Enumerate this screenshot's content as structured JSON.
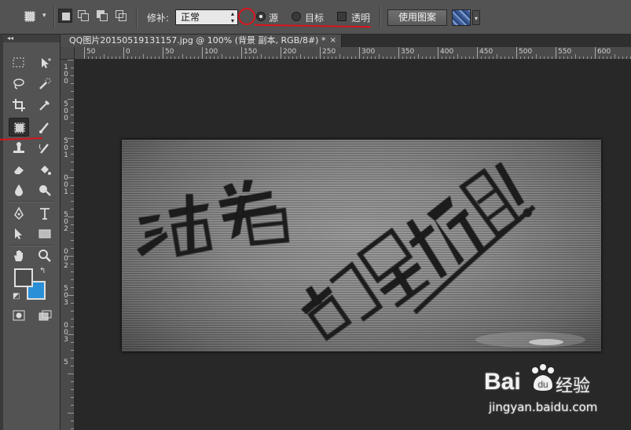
{
  "options_bar": {
    "tool_preset_icon": "patch-tool-icon",
    "patch_label": "修补:",
    "patch_mode": "正常",
    "source_label": "源",
    "destination_label": "目标",
    "transparent_label": "透明",
    "use_pattern_label": "使用图案",
    "source_selected": true,
    "destination_selected": false,
    "transparent_checked": false
  },
  "document": {
    "tab_title": "QQ图片20150519131157.jpg @ 100% (背景 副本, RGB/8#) *",
    "close_glyph": "×"
  },
  "rulers": {
    "horizontal_labels": [
      "50",
      "0",
      "50",
      "100",
      "150",
      "200",
      "250",
      "300",
      "350",
      "400",
      "450",
      "500",
      "550",
      "600"
    ],
    "vertical_labels": [
      "1",
      "0",
      "0",
      "5",
      "0",
      "0",
      "5",
      "0",
      "1",
      "0",
      "0",
      "1",
      "5",
      "0",
      "2",
      "0",
      "0",
      "2",
      "5",
      "0",
      "3",
      "0",
      "0",
      "3",
      "5"
    ]
  },
  "toolbar": {
    "collapse_glyph": "◂◂",
    "active_tool": "patch-tool"
  },
  "colors": {
    "foreground": "#4a4a4a",
    "background": "#2a8fd6",
    "annotation": "#d9141b"
  },
  "watermark": {
    "brand": "Bai",
    "brand_tail": "du",
    "product": "经验",
    "url": "jingyan.baidu.com"
  }
}
